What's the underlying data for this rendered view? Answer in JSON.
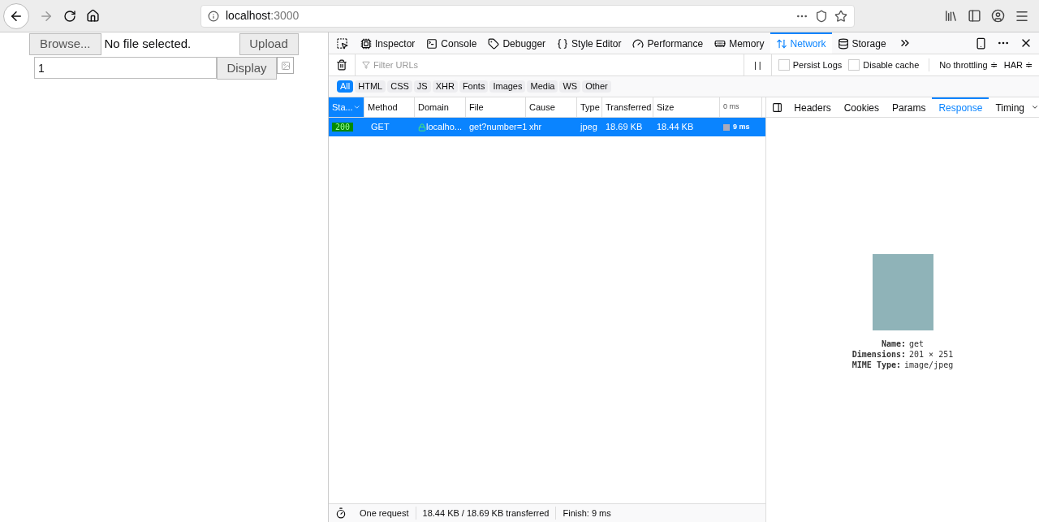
{
  "browser": {
    "url_host": "localhost",
    "url_port": ":3000"
  },
  "page": {
    "browse_button": "Browse...",
    "file_status": "No file selected.",
    "upload_button": "Upload",
    "number_value": "1",
    "display_button": "Display"
  },
  "devtools": {
    "tools": [
      {
        "label": "Inspector",
        "selected": false
      },
      {
        "label": "Console",
        "selected": false
      },
      {
        "label": "Debugger",
        "selected": false
      },
      {
        "label": "Style Editor",
        "selected": false
      },
      {
        "label": "Performance",
        "selected": false
      },
      {
        "label": "Memory",
        "selected": false
      },
      {
        "label": "Network",
        "selected": true
      },
      {
        "label": "Storage",
        "selected": false
      }
    ],
    "filter_placeholder": "Filter URLs",
    "pause_label": "| |",
    "options": [
      {
        "label": "Persist Logs",
        "checked": false
      },
      {
        "label": "Disable cache",
        "checked": false
      }
    ],
    "throttling": "No throttling ≑",
    "har": "HAR ≑",
    "type_filters": [
      {
        "label": "All",
        "selected": true
      },
      {
        "label": "HTML",
        "selected": false
      },
      {
        "label": "CSS",
        "selected": false
      },
      {
        "label": "JS",
        "selected": false
      },
      {
        "label": "XHR",
        "selected": false
      },
      {
        "label": "Fonts",
        "selected": false
      },
      {
        "label": "Images",
        "selected": false
      },
      {
        "label": "Media",
        "selected": false
      },
      {
        "label": "WS",
        "selected": false
      },
      {
        "label": "Other",
        "selected": false
      }
    ],
    "columns": [
      "Sta...",
      "Method",
      "Domain",
      "File",
      "Cause",
      "Type",
      "Transferred",
      "Size",
      "0 ms"
    ],
    "requests": [
      {
        "selected": true,
        "status": "200",
        "method": "GET",
        "domain": "localho...",
        "file": "get?number=1",
        "cause": "xhr",
        "type": "jpeg",
        "transferred": "18.69 KB",
        "size": "18.44 KB",
        "timing": "9 ms"
      }
    ],
    "detail_tabs": [
      {
        "label": "Headers",
        "selected": false
      },
      {
        "label": "Cookies",
        "selected": false
      },
      {
        "label": "Params",
        "selected": false
      },
      {
        "label": "Response",
        "selected": true
      },
      {
        "label": "Timing",
        "selected": false
      }
    ],
    "preview": [
      {
        "key": "Name:",
        "value": "get"
      },
      {
        "key": "Dimensions:",
        "value": "201 × 251"
      },
      {
        "key": "MIME Type:",
        "value": "image/jpeg"
      }
    ],
    "status_bar": {
      "requests": "One request",
      "transferred": "18.44 KB / 18.69 KB transferred",
      "finish": "Finish: 9 ms"
    }
  }
}
